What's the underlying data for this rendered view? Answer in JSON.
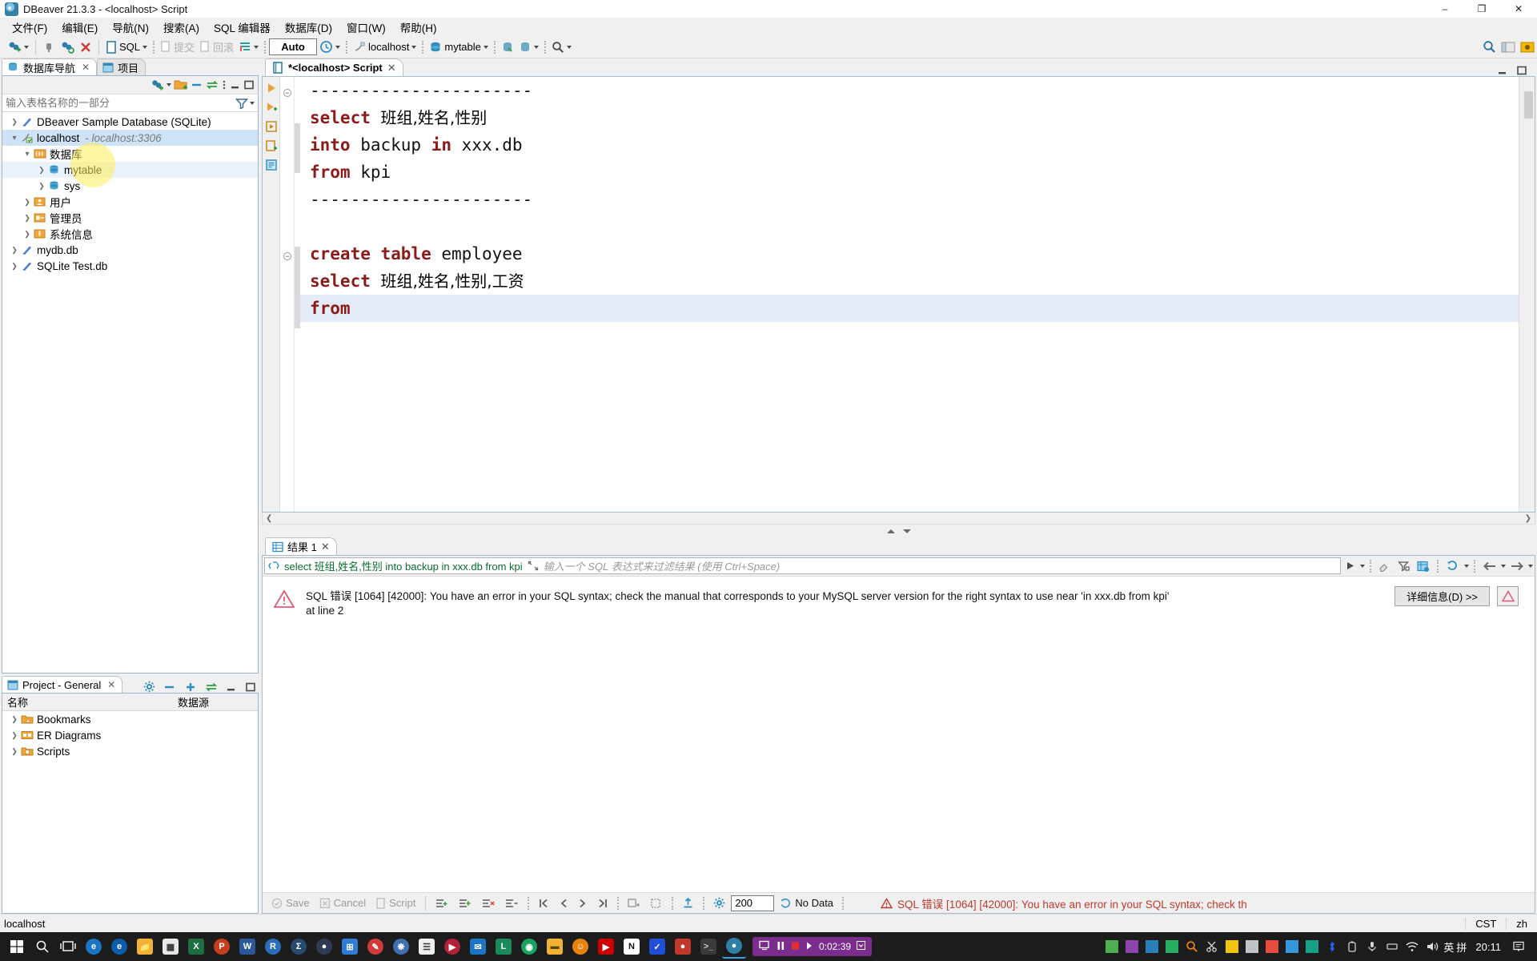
{
  "window": {
    "title": "DBeaver 21.3.3 - <localhost> Script",
    "app_icon": "dbeaver-icon",
    "minimize": "–",
    "maximize": "❐",
    "close": "✕"
  },
  "menubar": {
    "items": [
      {
        "label": "文件(F)",
        "name": "menu-file"
      },
      {
        "label": "编辑(E)",
        "name": "menu-edit"
      },
      {
        "label": "导航(N)",
        "name": "menu-navigate"
      },
      {
        "label": "搜索(A)",
        "name": "menu-search"
      },
      {
        "label": "SQL 编辑器",
        "name": "menu-sql-editor"
      },
      {
        "label": "数据库(D)",
        "name": "menu-database"
      },
      {
        "label": "窗口(W)",
        "name": "menu-window"
      },
      {
        "label": "帮助(H)",
        "name": "menu-help"
      }
    ]
  },
  "toolbar": {
    "sql_label": "SQL",
    "commit_label": "提交",
    "rollback_label": "回滚",
    "auto_label": "Auto",
    "connection": "localhost",
    "schema": "mytable",
    "search_icon": "search-icon",
    "perspective_icon": "perspective-icon"
  },
  "navigator": {
    "tabs": [
      {
        "label": "数据库导航",
        "active": true,
        "name": "tab-database-navigator"
      },
      {
        "label": "项目",
        "active": false,
        "name": "tab-projects"
      }
    ],
    "search_placeholder": "输入表格名称的一部分",
    "search_value": "",
    "tree": [
      {
        "label": "DBeaver Sample Database (SQLite)",
        "indent": 0,
        "state": "closed",
        "icon": "sqlite-db-icon",
        "selected": false
      },
      {
        "label": "localhost",
        "sub": "- localhost:3306",
        "indent": 0,
        "state": "open",
        "icon": "mysql-conn-icon",
        "selected": true
      },
      {
        "label": "数据库",
        "indent": 1,
        "state": "open",
        "icon": "folder-db-icon",
        "selected": false
      },
      {
        "label": "mytable",
        "indent": 2,
        "state": "closed",
        "icon": "database-icon",
        "selected": false,
        "hover": true
      },
      {
        "label": "sys",
        "indent": 2,
        "state": "closed",
        "icon": "database-icon",
        "selected": false
      },
      {
        "label": "用户",
        "indent": 1,
        "state": "closed",
        "icon": "users-folder-icon",
        "selected": false
      },
      {
        "label": "管理员",
        "indent": 1,
        "state": "closed",
        "icon": "admin-folder-icon",
        "selected": false
      },
      {
        "label": "系统信息",
        "indent": 1,
        "state": "closed",
        "icon": "system-info-folder-icon",
        "selected": false
      },
      {
        "label": "mydb.db",
        "indent": 0,
        "state": "closed",
        "icon": "sqlite-db-icon",
        "selected": false
      },
      {
        "label": "SQLite Test.db",
        "indent": 0,
        "state": "closed",
        "icon": "sqlite-db-icon",
        "selected": false
      }
    ]
  },
  "project_panel": {
    "tab_label": "Project - General",
    "col_name": "名称",
    "col_datasource": "数据源",
    "rows": [
      {
        "label": "Bookmarks",
        "icon": "bookmarks-folder-icon",
        "datasource": ""
      },
      {
        "label": "ER Diagrams",
        "icon": "er-diagrams-folder-icon",
        "datasource": ""
      },
      {
        "label": "Scripts",
        "icon": "scripts-folder-icon",
        "datasource": ""
      }
    ]
  },
  "editor": {
    "tab_label": "*<localhost> Script",
    "lines": [
      {
        "id": "l1",
        "tokens": [
          {
            "t": "----------------------",
            "c": "plain"
          }
        ],
        "fold": true,
        "changed": false,
        "current": false
      },
      {
        "id": "l2",
        "tokens": [
          {
            "t": "select ",
            "c": "kw"
          },
          {
            "t": "班组,姓名,性别",
            "c": "cjk"
          }
        ],
        "fold": false,
        "changed": false,
        "current": false
      },
      {
        "id": "l3",
        "tokens": [
          {
            "t": "into ",
            "c": "kw"
          },
          {
            "t": "backup ",
            "c": "plain"
          },
          {
            "t": "in ",
            "c": "kw"
          },
          {
            "t": "xxx.db",
            "c": "plain"
          }
        ],
        "fold": false,
        "changed": true,
        "current": false
      },
      {
        "id": "l4",
        "tokens": [
          {
            "t": "from ",
            "c": "kw"
          },
          {
            "t": "kpi",
            "c": "plain"
          }
        ],
        "fold": false,
        "changed": true,
        "current": false
      },
      {
        "id": "l5",
        "tokens": [
          {
            "t": "----------------------",
            "c": "plain"
          }
        ],
        "fold": false,
        "changed": false,
        "current": false
      },
      {
        "id": "l6",
        "tokens": [
          {
            "t": "",
            "c": "plain"
          }
        ],
        "fold": false,
        "changed": false,
        "current": false
      },
      {
        "id": "l7",
        "tokens": [
          {
            "t": "create table ",
            "c": "kw"
          },
          {
            "t": "employee",
            "c": "plain"
          }
        ],
        "fold": true,
        "changed": true,
        "current": false
      },
      {
        "id": "l8",
        "tokens": [
          {
            "t": "select ",
            "c": "kw"
          },
          {
            "t": "班组,姓名,性别,工资",
            "c": "cjk"
          }
        ],
        "fold": false,
        "changed": true,
        "current": false
      },
      {
        "id": "l9",
        "tokens": [
          {
            "t": "from",
            "c": "kw"
          }
        ],
        "fold": false,
        "changed": true,
        "current": true
      }
    ]
  },
  "results": {
    "tab_label": "结果 1",
    "filter_sql": "select 班组,姓名,性别 into backup in xxx.db from kpi",
    "filter_placeholder": "输入一个 SQL 表达式来过滤结果 (使用 Ctrl+Space)",
    "error_text": "SQL 错误 [1064] [42000]: You have an error in your SQL syntax; check the manual that corresponds to your MySQL server version for the right syntax to use near 'in xxx.db from kpi' at line 2",
    "detail_button": "详细信息(D) >>",
    "warn_icon": "warning-triangle-icon",
    "footer": {
      "save": "Save",
      "cancel": "Cancel",
      "script": "Script",
      "row_limit": "200",
      "no_data": "No Data",
      "status_error": "SQL 错误 [1064] [42000]: You have an error in your SQL syntax; check th"
    }
  },
  "statusbar": {
    "left": "localhost",
    "cells": [
      "CST",
      "zh"
    ]
  },
  "taskbar": {
    "start_icon": "windows-start-icon",
    "search_icon": "search-icon",
    "taskview_icon": "task-view-icon",
    "apps": [
      {
        "name": "edge-icon",
        "glyph": "e",
        "bg": "#1b74c4",
        "shape": "cir",
        "color": "#ffffff"
      },
      {
        "name": "ie-icon",
        "glyph": "e",
        "bg": "#0b5cab",
        "shape": "cir",
        "color": "#ffffff"
      },
      {
        "name": "file-explorer-icon",
        "glyph": "",
        "bg": "#f2b233",
        "shape": "sq",
        "color": "#333333"
      },
      {
        "name": "store-icon",
        "glyph": "",
        "bg": "#e8e8e8",
        "shape": "sq",
        "color": "#333333"
      },
      {
        "name": "excel-icon",
        "glyph": "X",
        "bg": "#1d6f42",
        "shape": "sq",
        "color": "#ffffff"
      },
      {
        "name": "powerpoint-icon",
        "glyph": "P",
        "bg": "#c43e1c",
        "shape": "cir",
        "color": "#ffffff"
      },
      {
        "name": "word-icon",
        "glyph": "W",
        "bg": "#2b579a",
        "shape": "sq",
        "color": "#ffffff"
      },
      {
        "name": "r-studio-icon",
        "glyph": "R",
        "bg": "#2a6ebb",
        "shape": "cir",
        "color": "#ffffff"
      },
      {
        "name": "sigma-app-icon",
        "glyph": "Σ",
        "bg": "#27496d",
        "shape": "cir",
        "color": "#ffffff"
      },
      {
        "name": "location-app-icon",
        "glyph": "♦",
        "bg": "#2d3b55",
        "shape": "cir",
        "color": "#ffffff"
      },
      {
        "name": "calculator-icon",
        "glyph": "",
        "bg": "#2f7bd6",
        "shape": "sq",
        "color": "#ffffff"
      },
      {
        "name": "paint-icon",
        "glyph": "",
        "bg": "#d03a3a",
        "shape": "cir",
        "color": "#ffffff"
      },
      {
        "name": "pinwheel-icon",
        "glyph": "",
        "bg": "#3f6fb0",
        "shape": "cir",
        "color": "#ffffff"
      },
      {
        "name": "notepad-icon",
        "glyph": "",
        "bg": "#efefef",
        "shape": "sq",
        "color": "#333333"
      },
      {
        "name": "kmplayer-icon",
        "glyph": "",
        "bg": "#b22234",
        "shape": "cir",
        "color": "#ffffff"
      },
      {
        "name": "mail-icon",
        "glyph": "✉",
        "bg": "#1b74c4",
        "shape": "sq",
        "color": "#ffffff"
      },
      {
        "name": "lingoes-icon",
        "glyph": "L",
        "bg": "#1b8a5a",
        "shape": "sq",
        "color": "#ffffff"
      },
      {
        "name": "chrome-icon",
        "glyph": "",
        "bg": "#1aa260",
        "shape": "cir",
        "color": "#ffffff"
      },
      {
        "name": "folder-yellow-icon",
        "glyph": "",
        "bg": "#f2b233",
        "shape": "sq",
        "color": "#333333"
      },
      {
        "name": "smiley-icon",
        "glyph": "",
        "bg": "#e8820c",
        "shape": "cir",
        "color": "#ffffff"
      },
      {
        "name": "youtube-icon",
        "glyph": "▶",
        "bg": "#cc0000",
        "shape": "sq",
        "color": "#ffffff"
      },
      {
        "name": "notion-icon",
        "glyph": "N",
        "bg": "#ffffff",
        "shape": "sq",
        "color": "#111111"
      },
      {
        "name": "feishu-icon",
        "glyph": "",
        "bg": "#1f4fd8",
        "shape": "sq",
        "color": "#ffffff"
      },
      {
        "name": "wechat-dev-icon",
        "glyph": "",
        "bg": "#c0392b",
        "shape": "sq",
        "color": "#ffffff"
      },
      {
        "name": "terminal-icon",
        "glyph": "",
        "bg": "#3a3a3a",
        "shape": "sq",
        "color": "#cccccc"
      },
      {
        "name": "dbeaver-taskbar-icon",
        "glyph": "",
        "bg": "#2e7fa8",
        "shape": "cir",
        "color": "#ffffff"
      }
    ],
    "media": {
      "time": "0:02:39",
      "pause_icon": "pause-icon",
      "stop_icon": "stop-icon",
      "play_icon": "play-icon",
      "record_icon": "screen-record-icon",
      "expand_icon": "chevron-down-icon",
      "bg": "#7b2d8e"
    },
    "tray": [
      {
        "name": "tray-green-icon",
        "bg": "#4caf50"
      },
      {
        "name": "tray-purple-icon",
        "bg": "#8e44ad"
      },
      {
        "name": "tray-globe-icon",
        "bg": "#2980b9"
      },
      {
        "name": "tray-green2-icon",
        "bg": "#27ae60"
      },
      {
        "name": "tray-search-icon",
        "bg": "#e67e22"
      },
      {
        "name": "tray-scissors-icon",
        "bg": "#95a5a6"
      },
      {
        "name": "tray-smiley-icon",
        "bg": "#f1c40f"
      },
      {
        "name": "tray-cloud-icon",
        "bg": "#bdc3c7"
      },
      {
        "name": "tray-orange-icon",
        "bg": "#e74c3c"
      },
      {
        "name": "tray-blue-icon",
        "bg": "#3498db"
      },
      {
        "name": "tray-shield-icon",
        "bg": "#16a085"
      },
      {
        "name": "tray-bluetooth-icon",
        "bg": "#2962ff"
      },
      {
        "name": "tray-battery-icon",
        "bg": "#7f8c8d"
      },
      {
        "name": "tray-mic-icon",
        "bg": "#7f8c8d"
      },
      {
        "name": "tray-usb-icon",
        "bg": "#7f8c8d"
      }
    ],
    "wifi_icon": "wifi-icon",
    "volume_icon": "volume-icon",
    "ime_lang": "英",
    "ime_mode": "拼",
    "clock": "20:11",
    "notification_icon": "notification-icon"
  },
  "colors": {
    "accent": "#0a6b2e",
    "error": "#c0392b",
    "selection": "#cfe3f7",
    "keyword": "#8b1a1a",
    "taskbar_bg": "#1c1c1c"
  }
}
